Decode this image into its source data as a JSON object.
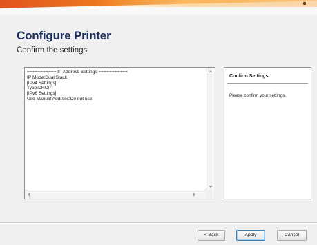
{
  "wizard": {
    "title": "Configure Printer",
    "subtitle": "Confirm the settings"
  },
  "settings_text": "=========== IP Address Settings ===========\nIP Mode:Dual Stack\n[IPv4 Settings]\nType:DHCP\n[IPv6 Settings]\nUse Manual Address:Do not use",
  "info_panel": {
    "title": "Confirm Settings",
    "text": "Please confirm your settings."
  },
  "buttons": {
    "back": "< Back",
    "apply": "Apply",
    "cancel": "Cancel"
  },
  "colors": {
    "title": "#1a2e5c",
    "banner_orange": "#ef7f1f",
    "default_button_border": "#3c7fb1"
  }
}
